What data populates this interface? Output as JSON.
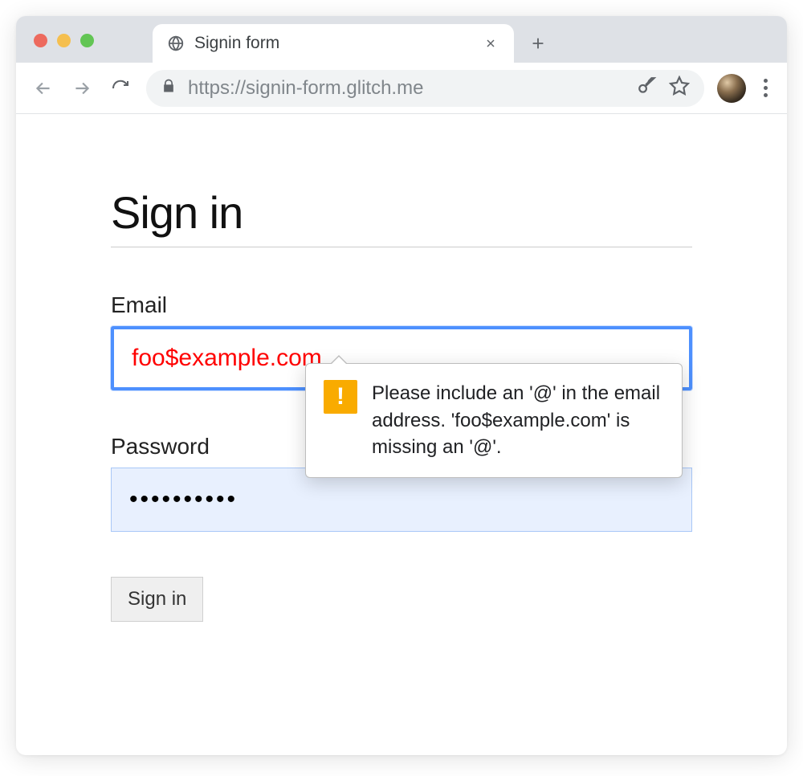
{
  "browser": {
    "tab_title": "Signin form",
    "url": "https://signin-form.glitch.me"
  },
  "page": {
    "heading": "Sign in",
    "email_label": "Email",
    "email_value": "foo$example.com",
    "password_label": "Password",
    "password_value": "••••••••••",
    "submit_label": "Sign in"
  },
  "tooltip": {
    "message": "Please include an '@' in the email address. 'foo$example.com' is missing an '@'."
  },
  "icons": {
    "globe": "globe-icon",
    "close": "close-icon",
    "new_tab": "plus-icon",
    "back": "back-icon",
    "forward": "forward-icon",
    "reload": "reload-icon",
    "lock": "lock-icon",
    "key": "key-icon",
    "star": "star-icon",
    "menu": "menu-icon",
    "warning": "warning-icon"
  }
}
